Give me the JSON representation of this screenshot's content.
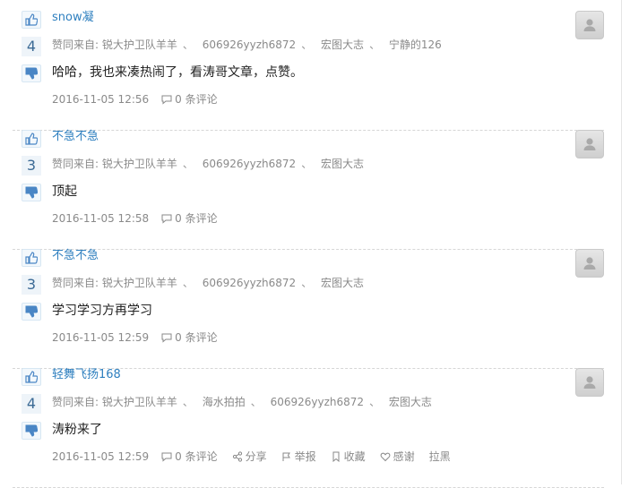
{
  "comments": [
    {
      "username": "snow凝",
      "votes": "4",
      "likers_prefix": "赞同来自:",
      "likers": [
        "锐大护卫队羊羊",
        "606926yyzh6872",
        "宏图大志",
        "宁静的126"
      ],
      "text": "哈哈，我也来凑热闹了，看涛哥文章，点赞。",
      "time": "2016-11-05 12:56",
      "comments_label": "0 条评论"
    },
    {
      "username": "不急不急",
      "votes": "3",
      "likers_prefix": "赞同来自:",
      "likers": [
        "锐大护卫队羊羊",
        "606926yyzh6872",
        "宏图大志"
      ],
      "text": "顶起",
      "time": "2016-11-05 12:58",
      "comments_label": "0 条评论"
    },
    {
      "username": "不急不急",
      "votes": "3",
      "likers_prefix": "赞同来自:",
      "likers": [
        "锐大护卫队羊羊",
        "606926yyzh6872",
        "宏图大志"
      ],
      "text": "学习学习方再学习",
      "time": "2016-11-05 12:59",
      "comments_label": "0 条评论"
    },
    {
      "username": "轻舞飞扬168",
      "votes": "4",
      "likers_prefix": "赞同来自:",
      "likers": [
        "锐大护卫队羊羊",
        "海水拍拍",
        "606926yyzh6872",
        "宏图大志"
      ],
      "text": "涛粉来了",
      "time": "2016-11-05 12:59",
      "comments_label": "0 条评论",
      "actions": {
        "share": "分享",
        "report": "举报",
        "favorite": "收藏",
        "thanks": "感谢",
        "block": "拉黑"
      }
    }
  ],
  "separator": "、",
  "icons": {
    "upvote": "thumbs-up-icon",
    "downvote": "thumbs-down-icon",
    "comment": "speech-bubble-icon",
    "avatar": "default-user-icon"
  },
  "colors": {
    "username": "#2e7fbf",
    "vote_count": "#3b6a95"
  }
}
